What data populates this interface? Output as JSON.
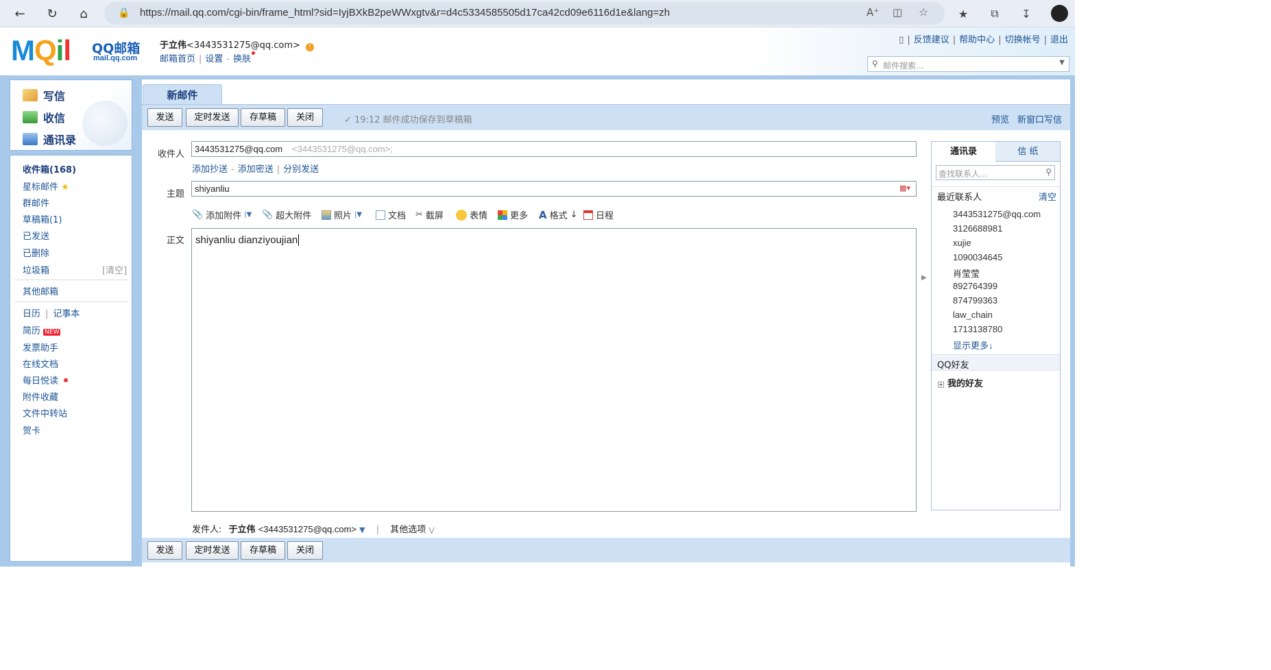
{
  "browser": {
    "url": "https://mail.qq.com/cgi-bin/frame_html?sid=IyjBXkB2peWWxgtv&r=d4c5334585505d17ca42cd09e6116d1e&lang=zh"
  },
  "header": {
    "logo_text": "MQil",
    "brand": "QQ邮箱",
    "domain": "mail.qq.com",
    "user_name": "于立伟",
    "user_email": "<3443531275@qq.com>",
    "links": [
      "邮箱首页",
      "设置",
      "换肤"
    ],
    "right_links": [
      "反馈建议",
      "帮助中心",
      "切换帐号",
      "退出"
    ],
    "search_placeholder": "邮件搜索..."
  },
  "sidebar": {
    "actions": [
      {
        "label": "写信",
        "icon": "write-icon"
      },
      {
        "label": "收信",
        "icon": "inbox-icon"
      },
      {
        "label": "通讯录",
        "icon": "contacts-icon"
      }
    ],
    "folders": [
      {
        "label": "收件箱(168)"
      },
      {
        "label": "星标邮件"
      },
      {
        "label": "群邮件"
      },
      {
        "label": "草稿箱(1)"
      },
      {
        "label": "已发送"
      },
      {
        "label": "已删除"
      },
      {
        "label": "垃圾箱",
        "extra": "[清空]"
      }
    ],
    "other_mail": "其他邮箱",
    "tools": [
      {
        "label": "日历",
        "label2": "记事本"
      },
      {
        "label": "简历",
        "badge": "NEW"
      },
      {
        "label": "发票助手"
      },
      {
        "label": "在线文档"
      },
      {
        "label": "每日悦读"
      },
      {
        "label": "附件收藏"
      },
      {
        "label": "文件中转站"
      },
      {
        "label": "贺卡"
      }
    ]
  },
  "compose": {
    "tab": "新邮件",
    "buttons": [
      "发送",
      "定时发送",
      "存草稿",
      "关闭"
    ],
    "save_message": "19:12 邮件成功保存到草稿箱",
    "preview": "预览",
    "new_window": "新窗口写信",
    "to_label": "收件人",
    "to_value": "3443531275@qq.com",
    "to_hint": "<3443531275@qq.com>;",
    "cc_links": [
      "添加抄送",
      "添加密送",
      "分别发送"
    ],
    "subject_label": "主题",
    "subject_value": "shiyanliu",
    "toolbar": [
      "添加附件",
      "超大附件",
      "照片",
      "文档",
      "截屏",
      "表情",
      "更多",
      "格式",
      "日程"
    ],
    "body_label": "正文",
    "body_text": "shiyanliu dianziyoujian",
    "sender_label": "发件人:",
    "sender_name": "于立伟",
    "sender_email": "<3443531275@qq.com>",
    "other_options": "其他选项"
  },
  "contacts_panel": {
    "tabs": [
      "通讯录",
      "信 纸"
    ],
    "search_placeholder": "查找联系人...",
    "recent_label": "最近联系人",
    "clear_label": "清空",
    "recent": [
      "3443531275@qq.com",
      "3126688981",
      "xujie",
      "1090034645",
      "肖莹莹",
      "892764399",
      "874799363",
      "law_chain",
      "1713138780",
      "显示更多↓"
    ],
    "qq_friends": "QQ好友",
    "my_friends": "我的好友"
  },
  "colors": {
    "frame_blue": "#a9c9ea",
    "toolbar_blue": "#cde0f4",
    "link_blue": "#1e5494"
  }
}
